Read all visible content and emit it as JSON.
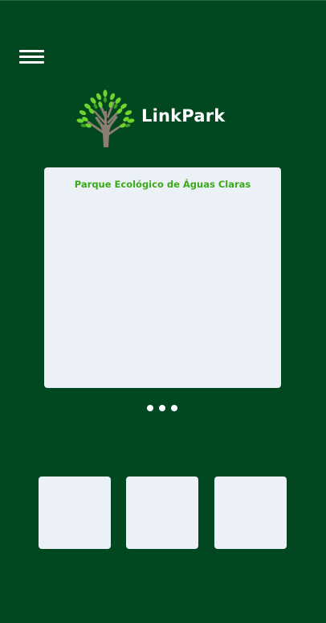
{
  "app": {
    "brand_name": "LinkPark",
    "logo_icon": "tree-icon"
  },
  "header": {
    "menu_icon": "hamburger-menu-icon"
  },
  "carousel": {
    "current_title": "Parque Ecológico de Águas Claras",
    "indicator_count": 3
  },
  "tiles": [
    {
      "label": ""
    },
    {
      "label": ""
    },
    {
      "label": ""
    }
  ],
  "colors": {
    "background": "#014821",
    "card": "#ecf1f8",
    "accent_green": "#3aaa16",
    "text_light": "#ffffff"
  }
}
